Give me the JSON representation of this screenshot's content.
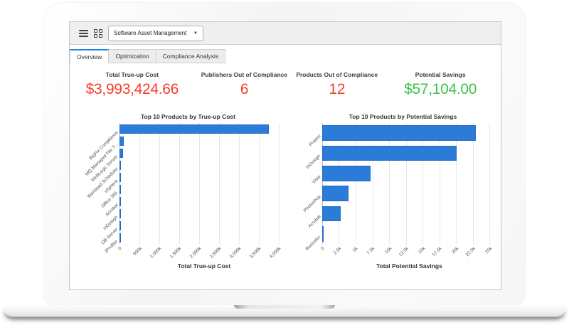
{
  "header": {
    "dropdown_value": "Software Asset Management",
    "menu_icon": "hamburger-menu-icon",
    "apps_icon": "apps-grid-icon",
    "caret_icon": "chevron-down-icon",
    "caret_glyph": "▼"
  },
  "tabs": [
    {
      "label": "Overview",
      "active": true
    },
    {
      "label": "Optimization",
      "active": false
    },
    {
      "label": "Compliance Analysis",
      "active": false
    }
  ],
  "kpis": [
    {
      "label": "Total True-up Cost",
      "value": "$3,993,424.66",
      "color": "#f93b2b"
    },
    {
      "label": "Publishers Out of Compliance",
      "value": "6",
      "color": "#f93b2b"
    },
    {
      "label": "Products Out of Compliance",
      "value": "12",
      "color": "#f93b2b"
    },
    {
      "label": "Potential Savings",
      "value": "$57,104.00",
      "color": "#3bc14a"
    }
  ],
  "colors": {
    "bar_blue": "#2b7bd8",
    "tab_accent": "#1f86e0",
    "kpi_red": "#f93b2b",
    "kpi_green": "#3bc14a"
  },
  "chart_data": [
    {
      "type": "bar",
      "orientation": "horizontal",
      "title": "Top 10 Products by True-up Cost",
      "xlabel": "Total True-up Cost",
      "categories": [
        "BigFix Compliance",
        "MQ Managed File T...",
        "WebLogic Server",
        "Workload Scheduler",
        "vSphere",
        "Office 365",
        "Acrobat",
        "InDesign",
        "DB Server",
        "JProfiler"
      ],
      "values": [
        3750000,
        105000,
        95000,
        28000,
        7000,
        4500,
        3000,
        2200,
        1500,
        1000
      ],
      "xlim": [
        0,
        4250000
      ],
      "tick_values": [
        0,
        500000,
        1000000,
        1500000,
        2000000,
        2500000,
        3000000,
        3500000,
        4000000
      ],
      "tick_labels": [
        "0",
        "500k",
        "1,000k",
        "1,500k",
        "2,000k",
        "2,500k",
        "3,000k",
        "3,500k",
        "4,000k"
      ],
      "grid": true,
      "legend": false,
      "bar_color": "#2b7bd8"
    },
    {
      "type": "bar",
      "orientation": "horizontal",
      "title": "Top 10 Products by Potential Savings",
      "xlabel": "Total Potential Savings",
      "categories": [
        "Project",
        "InDesign",
        "Visio",
        "Photoshop",
        "Acrobat",
        "Illustrator"
      ],
      "values": [
        22900,
        20100,
        7200,
        3900,
        2800,
        200
      ],
      "xlim": [
        0,
        26000
      ],
      "tick_values": [
        0,
        2500,
        5000,
        7500,
        10000,
        12500,
        15000,
        17500,
        20000,
        22500,
        25000
      ],
      "tick_labels": [
        "0",
        "2.5k",
        "5k",
        "7.5k",
        "10k",
        "12.5k",
        "15k",
        "17.5k",
        "20k",
        "22.5k",
        "25k"
      ],
      "grid": true,
      "legend": false,
      "bar_color": "#2b7bd8"
    }
  ]
}
